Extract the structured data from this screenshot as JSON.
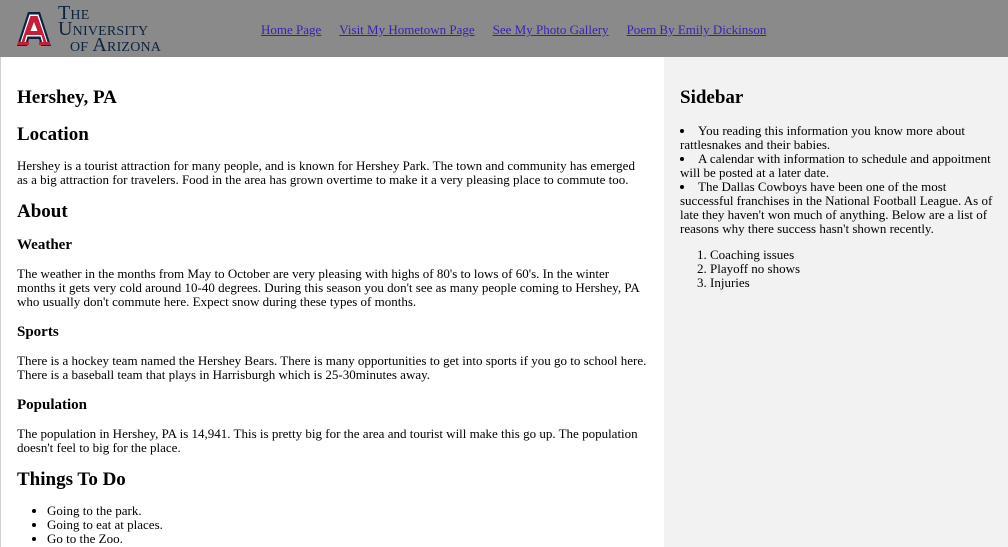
{
  "header": {
    "logo": {
      "line1": "The University",
      "line2": "of Arizona",
      "colors": {
        "red": "#c41e3a",
        "navy": "#0c2340"
      }
    },
    "nav": [
      {
        "label": "Home Page"
      },
      {
        "label": "Visit My Hometown Page"
      },
      {
        "label": "See My Photo Gallery"
      },
      {
        "label": "Poem By Emily Dickinson"
      }
    ],
    "background": "#8a8a8a"
  },
  "main": {
    "title": "Hershey, PA",
    "location": {
      "heading": "Location",
      "text": "Hershey is a tourist attraction for many people, and is known for Hershey Park. The town and community has emerged as a big attraction for travelers. Food in the area has grown overtime to make it a very pleasing place to commute too."
    },
    "about": {
      "heading": "About",
      "weather": {
        "heading": "Weather",
        "text": "The weather in the months from May to October are very pleasing with highs of 80's to lows of 60's. In the winter months it gets very cold around 10-40 degrees. During this season you don't see as many people coming to Hershey, PA who usually don't commute here. Expect snow during these types of months."
      },
      "sports": {
        "heading": "Sports",
        "text": "There is a hockey team named the Hershey Bears. There is many opportunities to get into sports if you go to school here. There is a baseball team that plays in Harrisburgh which is 25-30minutes away."
      },
      "population": {
        "heading": "Population",
        "text": "The population in Hershey, PA is 14,941. This is pretty big for the area and tourist will make this go up. The population doesn't feel to big for the place."
      }
    },
    "things": {
      "heading": "Things To Do",
      "items": [
        "Going to the park.",
        "Going to eat at places.",
        "Go to the Zoo."
      ]
    }
  },
  "sidebar": {
    "heading": "Sidebar",
    "bullets": [
      "You reading this information you know more about rattlesnakes and their babies.",
      "A calendar with information to schedule and appoitment will be posted at a later date.",
      "The Dallas Cowboys have been one of the most successful franchises in the National Football League. As of late they haven't won much of anything. Below are a list of reasons why there success hasn't shown recently."
    ],
    "reasons": [
      "Coaching issues",
      "Playoff no shows",
      "Injuries"
    ]
  }
}
